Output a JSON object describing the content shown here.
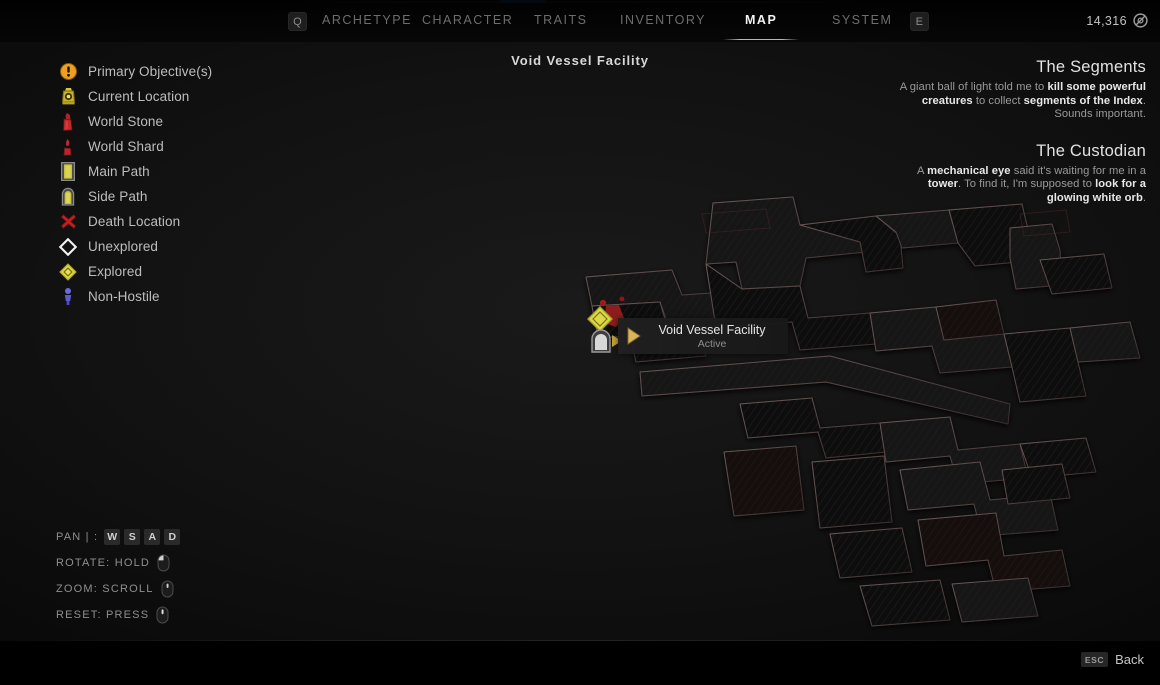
{
  "theme": {
    "bg": "#060606",
    "accent_blue": "#1878c8",
    "objective_orange": "#f0a020",
    "explored_yellow": "#e8e24a",
    "stone_red": "#c42a2a",
    "npc_blue": "#5a5ad8",
    "text_primary": "#e2e2e2",
    "text_muted": "#9a9a9a"
  },
  "topnav": {
    "prev_key": "Q",
    "next_key": "E",
    "tabs": [
      {
        "label": "ARCHETYPE",
        "active": false
      },
      {
        "label": "CHARACTER",
        "active": false
      },
      {
        "label": "TRAITS",
        "active": false
      },
      {
        "label": "INVENTORY",
        "active": false
      },
      {
        "label": "MAP",
        "active": true
      },
      {
        "label": "SYSTEM",
        "active": false
      }
    ],
    "currency": {
      "amount": "14,316",
      "icon": "scrap-coin-icon"
    }
  },
  "map": {
    "title": "Void Vessel Facility",
    "tooltip": {
      "name": "Void Vessel Facility",
      "state": "Active",
      "cursor": "map-cursor-icon"
    }
  },
  "legend": {
    "items": [
      {
        "icon": "primary-objective-icon",
        "label": "Primary Objective(s)"
      },
      {
        "icon": "current-location-icon",
        "label": "Current Location"
      },
      {
        "icon": "world-stone-icon",
        "label": "World Stone"
      },
      {
        "icon": "world-shard-icon",
        "label": "World Shard"
      },
      {
        "icon": "main-path-icon",
        "label": "Main Path"
      },
      {
        "icon": "side-path-icon",
        "label": "Side Path"
      },
      {
        "icon": "death-location-icon",
        "label": "Death Location"
      },
      {
        "icon": "unexplored-icon",
        "label": "Unexplored"
      },
      {
        "icon": "explored-icon",
        "label": "Explored"
      },
      {
        "icon": "non-hostile-icon",
        "label": "Non-Hostile"
      }
    ]
  },
  "quests": [
    {
      "title": "The Segments",
      "parts": [
        {
          "text": "A giant ball of light told me to ",
          "bold": false
        },
        {
          "text": "kill some powerful creatures",
          "bold": true
        },
        {
          "text": " to collect ",
          "bold": false
        },
        {
          "text": "segments of the Index",
          "bold": true
        },
        {
          "text": ". Sounds important.",
          "bold": false
        }
      ]
    },
    {
      "title": "The Custodian",
      "parts": [
        {
          "text": "A ",
          "bold": false
        },
        {
          "text": "mechanical eye",
          "bold": true
        },
        {
          "text": " said it's waiting for me in a ",
          "bold": false
        },
        {
          "text": "tower",
          "bold": true
        },
        {
          "text": ". To find it, I'm supposed to ",
          "bold": false
        },
        {
          "text": "look for a glowing white orb",
          "bold": true
        },
        {
          "text": ".",
          "bold": false
        }
      ]
    }
  ],
  "controls": [
    {
      "label": "PAN | :",
      "keys": [
        "W",
        "S",
        "A",
        "D"
      ],
      "mouse": null
    },
    {
      "label": "ROTATE: HOLD",
      "keys": [],
      "mouse": "mouse-left-button-icon"
    },
    {
      "label": "ZOOM: SCROLL",
      "keys": [],
      "mouse": "mouse-wheel-icon"
    },
    {
      "label": "RESET: PRESS",
      "keys": [],
      "mouse": "mouse-middle-button-icon"
    }
  ],
  "bottombar": {
    "back_key": "ESC",
    "back_label": "Back"
  }
}
